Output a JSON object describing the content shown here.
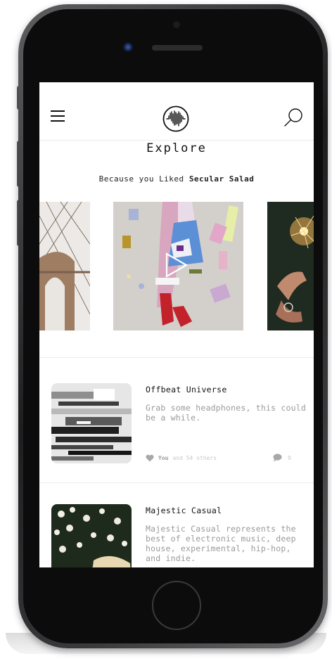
{
  "header": {
    "menu_icon": "hamburger-menu-icon",
    "logo_icon": "soundwave-logo-icon",
    "search_icon": "search-icon"
  },
  "page": {
    "title": "Explore",
    "subtitle_prefix": "Because you Liked ",
    "subtitle_highlight": "Secular Salad"
  },
  "carousel": {
    "items": [
      {
        "image": "bridge-photo"
      },
      {
        "image": "painted-illustration",
        "overlay_icon": "play-icon"
      },
      {
        "image": "sparkler-photo"
      }
    ]
  },
  "playlists": [
    {
      "title": "Offbeat Universe",
      "description": "Grab some headphones, this could be a while.",
      "likes_you": "You",
      "likes_others": "and 54 others",
      "comments": "9"
    },
    {
      "title": "Majestic Casual",
      "description": "Majestic Casual represents the best of electronic music, deep house, experimental, hip-hop, and indie."
    }
  ],
  "colors": {
    "text_primary": "#111111",
    "text_muted": "#9a9a9a",
    "divider": "#ececec"
  }
}
